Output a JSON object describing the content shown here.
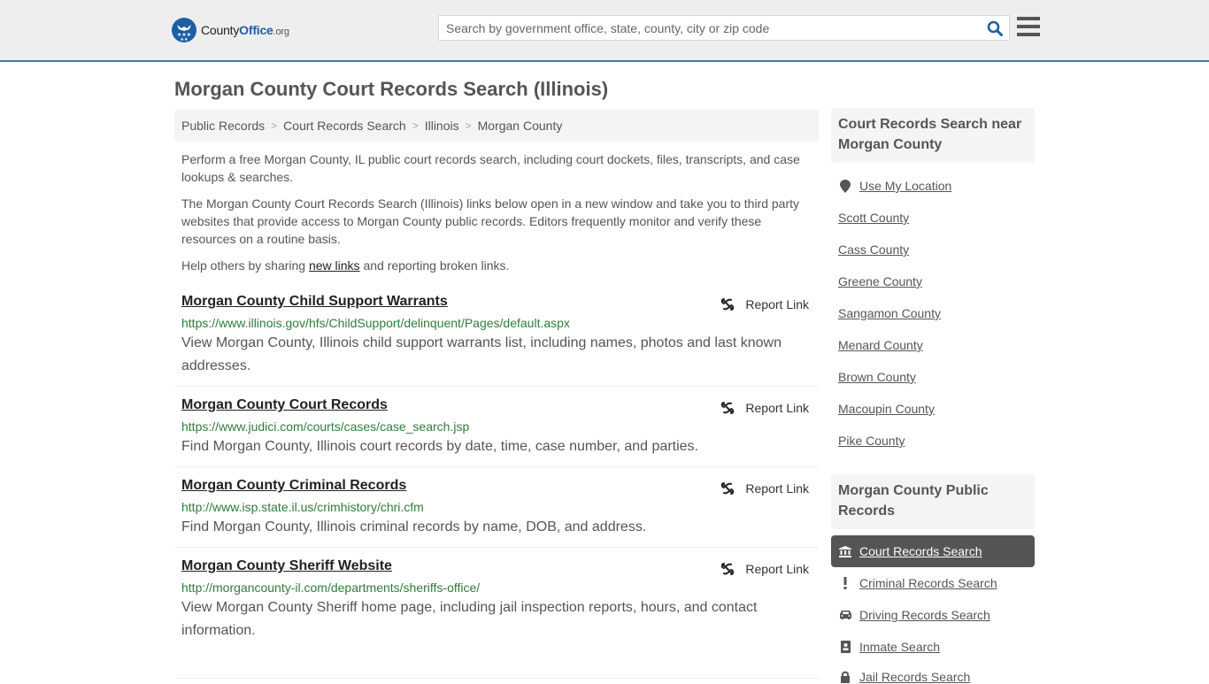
{
  "header": {
    "logo": {
      "county": "County",
      "office": "Office",
      "tld": ".org"
    },
    "search_placeholder": "Search by government office, state, county, city or zip code",
    "search_value": "",
    "colors": {
      "brand": "#1d5fa5",
      "accent_bar": "#3a7bb0"
    }
  },
  "page_title": "Morgan County Court Records Search (Illinois)",
  "breadcrumb": [
    "Public Records",
    "Court Records Search",
    "Illinois",
    "Morgan County"
  ],
  "intro": {
    "p1": "Perform a free Morgan County, IL public court records search, including court dockets, files, transcripts, and case lookups & searches.",
    "p2": "The Morgan County Court Records Search (Illinois) links below open in a new window and take you to third party websites that provide access to Morgan County public records. Editors frequently monitor and verify these resources on a routine basis.",
    "p3_before": "Help others by sharing ",
    "p3_link": "new links",
    "p3_after": " and reporting broken links."
  },
  "results": [
    {
      "title": "Morgan County Child Support Warrants",
      "url": "https://www.illinois.gov/hfs/ChildSupport/delinquent/Pages/default.aspx",
      "description": "View Morgan County, Illinois child support warrants list, including names, photos and last known addresses.",
      "report_label": "Report Link"
    },
    {
      "title": "Morgan County Court Records",
      "url": "https://www.judici.com/courts/cases/case_search.jsp",
      "description": "Find Morgan County, Illinois court records by date, time, case number, and parties.",
      "report_label": "Report Link"
    },
    {
      "title": "Morgan County Criminal Records",
      "url": "http://www.isp.state.il.us/crimhistory/chri.cfm",
      "description": "Find Morgan County, Illinois criminal records by name, DOB, and address.",
      "report_label": "Report Link"
    },
    {
      "title": "Morgan County Sheriff Website",
      "url": "http://morgancounty-il.com/departments/sheriffs-office/",
      "description": "View Morgan County Sheriff home page, including jail inspection reports, hours, and contact information.",
      "report_label": "Report Link"
    }
  ],
  "sidebar": {
    "nearby_heading": "Court Records Search near Morgan County",
    "use_location": "Use My Location",
    "nearby": [
      "Scott County",
      "Cass County",
      "Greene County",
      "Sangamon County",
      "Menard County",
      "Brown County",
      "Macoupin County",
      "Pike County"
    ],
    "public_records_heading": "Morgan County Public Records",
    "public_records": [
      {
        "label": "Court Records Search",
        "icon": "courthouse-icon",
        "active": true
      },
      {
        "label": "Criminal Records Search",
        "icon": "exclamation-icon",
        "active": false
      },
      {
        "label": "Driving Records Search",
        "icon": "car-icon",
        "active": false
      },
      {
        "label": "Inmate Search",
        "icon": "id-badge-icon",
        "active": false
      },
      {
        "label": "Jail Records Search",
        "icon": "lock-icon",
        "active": false
      }
    ]
  }
}
